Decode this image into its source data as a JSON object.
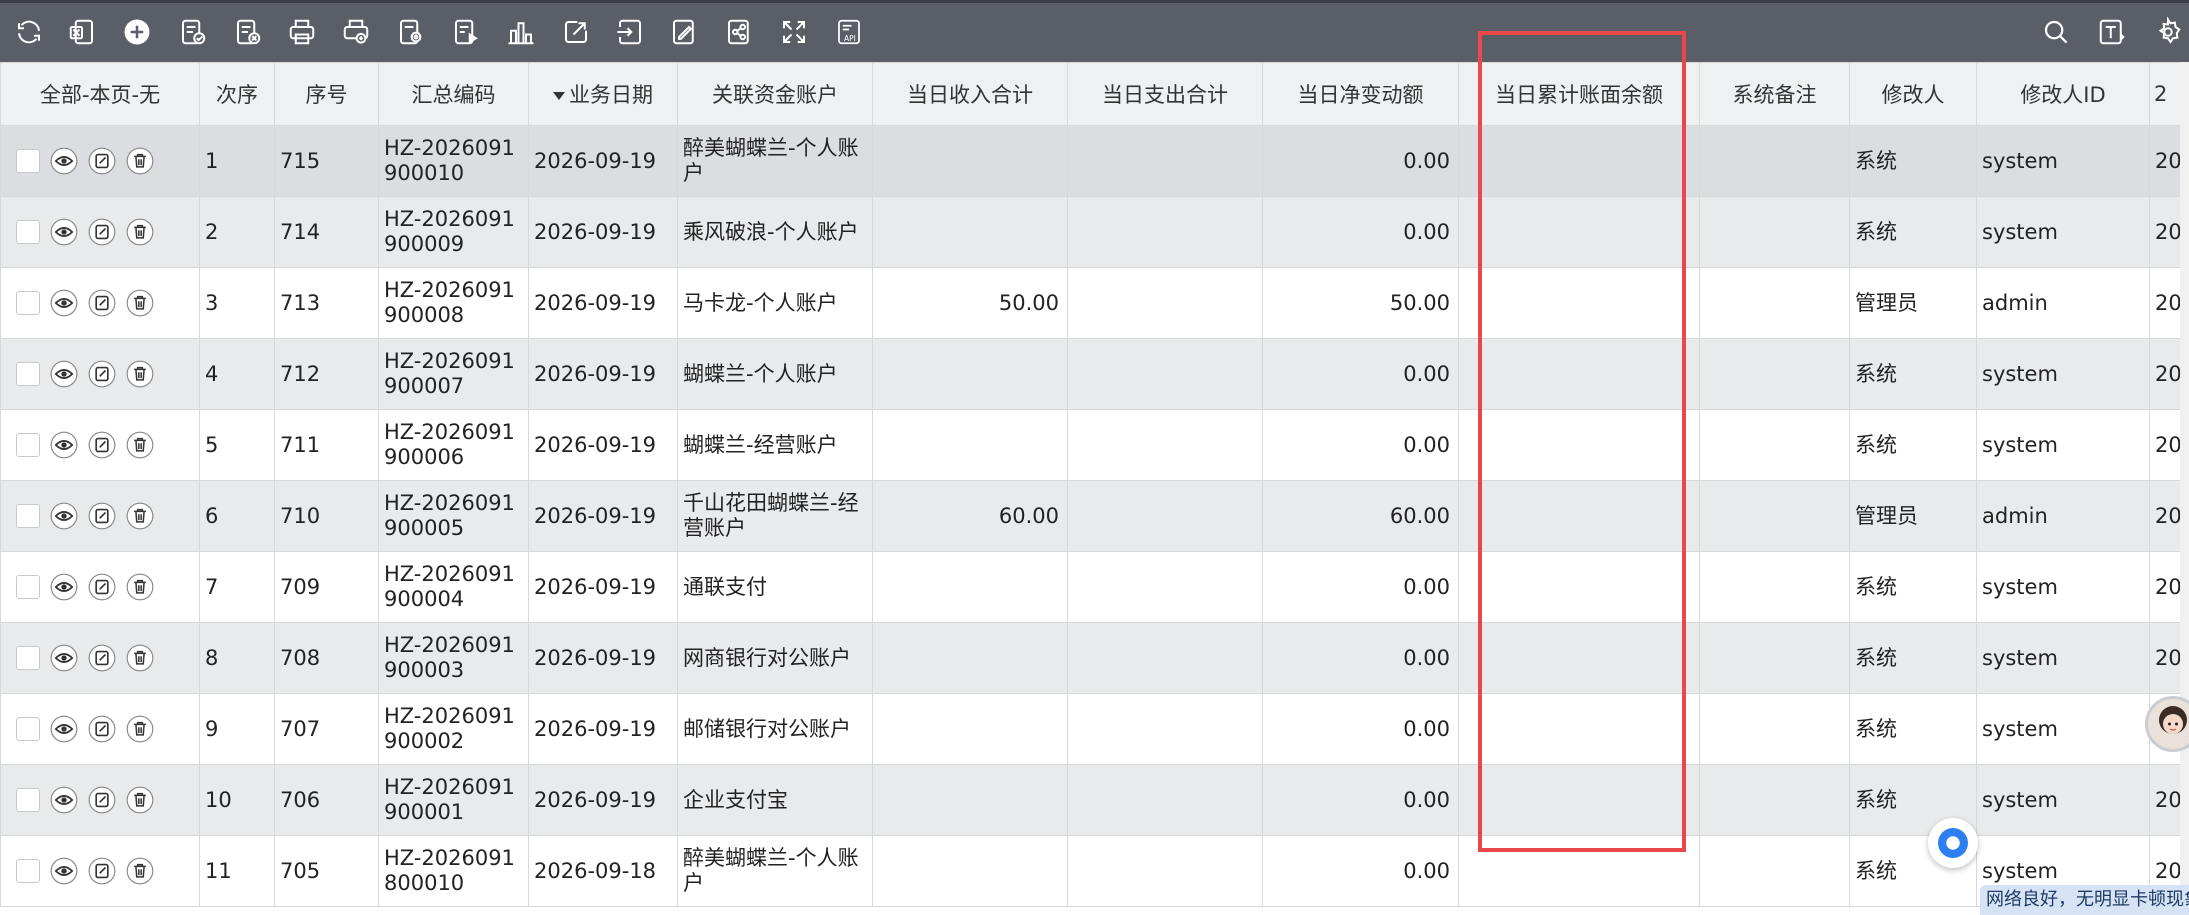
{
  "header": {
    "col_select": "全部-本页-无",
    "col_index": "次序",
    "col_seq": "序号",
    "col_code": "汇总编码",
    "col_date": "业务日期",
    "col_account": "关联资金账户",
    "col_income": "当日收入合计",
    "col_expense": "当日支出合计",
    "col_net": "当日净变动额",
    "col_balance": "当日累计账面余额",
    "col_remark": "系统备注",
    "col_modifier": "修改人",
    "col_modifier_id": "修改人ID",
    "col_extra": "2"
  },
  "rows": [
    {
      "index": "1",
      "seq": "715",
      "code": "HZ-2026091900010",
      "date": "2026-09-19",
      "account": "醉美蝴蝶兰-个人账户",
      "income": "",
      "expense": "",
      "net": "0.00",
      "balance": "",
      "remark": "",
      "modifier": "系统",
      "modifier_id": "system",
      "extra": "20"
    },
    {
      "index": "2",
      "seq": "714",
      "code": "HZ-2026091900009",
      "date": "2026-09-19",
      "account": "乘风破浪-个人账户",
      "income": "",
      "expense": "",
      "net": "0.00",
      "balance": "",
      "remark": "",
      "modifier": "系统",
      "modifier_id": "system",
      "extra": "20"
    },
    {
      "index": "3",
      "seq": "713",
      "code": "HZ-2026091900008",
      "date": "2026-09-19",
      "account": "马卡龙-个人账户",
      "income": "50.00",
      "expense": "",
      "net": "50.00",
      "balance": "",
      "remark": "",
      "modifier": "管理员",
      "modifier_id": "admin",
      "extra": "20"
    },
    {
      "index": "4",
      "seq": "712",
      "code": "HZ-2026091900007",
      "date": "2026-09-19",
      "account": "蝴蝶兰-个人账户",
      "income": "",
      "expense": "",
      "net": "0.00",
      "balance": "",
      "remark": "",
      "modifier": "系统",
      "modifier_id": "system",
      "extra": "20"
    },
    {
      "index": "5",
      "seq": "711",
      "code": "HZ-2026091900006",
      "date": "2026-09-19",
      "account": "蝴蝶兰-经营账户",
      "income": "",
      "expense": "",
      "net": "0.00",
      "balance": "",
      "remark": "",
      "modifier": "系统",
      "modifier_id": "system",
      "extra": "20"
    },
    {
      "index": "6",
      "seq": "710",
      "code": "HZ-2026091900005",
      "date": "2026-09-19",
      "account": "千山花田蝴蝶兰-经营账户",
      "income": "60.00",
      "expense": "",
      "net": "60.00",
      "balance": "",
      "remark": "",
      "modifier": "管理员",
      "modifier_id": "admin",
      "extra": "20"
    },
    {
      "index": "7",
      "seq": "709",
      "code": "HZ-2026091900004",
      "date": "2026-09-19",
      "account": "通联支付",
      "income": "",
      "expense": "",
      "net": "0.00",
      "balance": "",
      "remark": "",
      "modifier": "系统",
      "modifier_id": "system",
      "extra": "20"
    },
    {
      "index": "8",
      "seq": "708",
      "code": "HZ-2026091900003",
      "date": "2026-09-19",
      "account": "网商银行对公账户",
      "income": "",
      "expense": "",
      "net": "0.00",
      "balance": "",
      "remark": "",
      "modifier": "系统",
      "modifier_id": "system",
      "extra": "20"
    },
    {
      "index": "9",
      "seq": "707",
      "code": "HZ-2026091900002",
      "date": "2026-09-19",
      "account": "邮储银行对公账户",
      "income": "",
      "expense": "",
      "net": "0.00",
      "balance": "",
      "remark": "",
      "modifier": "系统",
      "modifier_id": "system",
      "extra": "20"
    },
    {
      "index": "10",
      "seq": "706",
      "code": "HZ-2026091900001",
      "date": "2026-09-19",
      "account": "企业支付宝",
      "income": "",
      "expense": "",
      "net": "0.00",
      "balance": "",
      "remark": "",
      "modifier": "系统",
      "modifier_id": "system",
      "extra": "20"
    },
    {
      "index": "11",
      "seq": "705",
      "code": "HZ-2026091800010",
      "date": "2026-09-18",
      "account": "醉美蝴蝶兰-个人账户",
      "income": "",
      "expense": "",
      "net": "0.00",
      "balance": "",
      "remark": "",
      "modifier": "系统",
      "modifier_id": "system",
      "extra": "20"
    }
  ],
  "status": {
    "network_text": "网络良好，无明显卡顿现象"
  },
  "icons": {
    "toolbar_left": [
      "refresh-icon",
      "export-excel-icon",
      "add-icon",
      "approve-icon",
      "reject-icon",
      "print-icon",
      "print-preview-icon",
      "print-settings-icon",
      "play-icon",
      "chart-icon",
      "edit-export-icon",
      "import-icon",
      "batch-edit-icon",
      "share-icon",
      "fullscreen-icon",
      "api-icon"
    ],
    "toolbar_right": [
      "search-icon",
      "text-format-icon",
      "settings-icon"
    ],
    "row_ops": [
      "view-icon",
      "edit-icon",
      "delete-icon"
    ]
  },
  "colors": {
    "toolbar": "#5a5e66",
    "highlight": "#e8474c",
    "row_alt": "#e9eaec"
  }
}
